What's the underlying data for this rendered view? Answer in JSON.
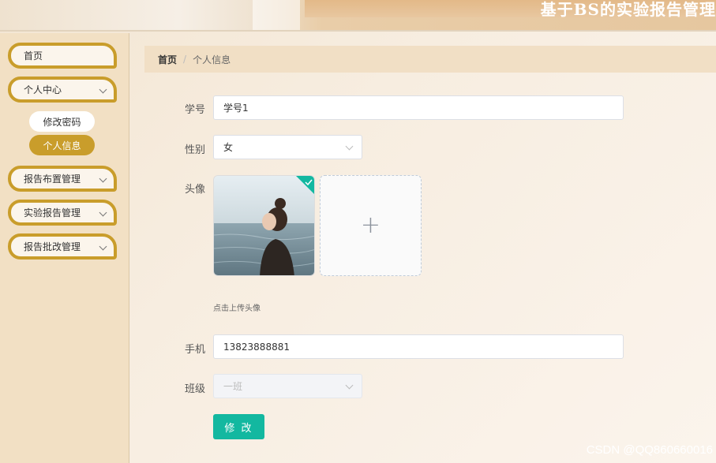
{
  "header": {
    "site_title": "基于BS的实验报告管理"
  },
  "sidebar": {
    "items": [
      {
        "label": "首页"
      },
      {
        "label": "个人中心"
      },
      {
        "label": "报告布置管理"
      },
      {
        "label": "实验报告管理"
      },
      {
        "label": "报告批改管理"
      }
    ],
    "sub_items": [
      {
        "label": "修改密码"
      },
      {
        "label": "个人信息"
      }
    ]
  },
  "breadcrumb": {
    "home": "首页",
    "separator": "/",
    "current": "个人信息"
  },
  "form": {
    "student_id": {
      "label": "学号",
      "value": "学号1"
    },
    "gender": {
      "label": "性别",
      "value": "女"
    },
    "avatar": {
      "label": "头像",
      "tip": "点击上传头像"
    },
    "phone": {
      "label": "手机",
      "value": "13823888881"
    },
    "class": {
      "label": "班级",
      "value": "一班"
    },
    "submit_label": "修 改"
  },
  "watermark": "CSDN @QQ860660016",
  "colors": {
    "accent": "#c99d2b",
    "button": "#13b8a0"
  }
}
